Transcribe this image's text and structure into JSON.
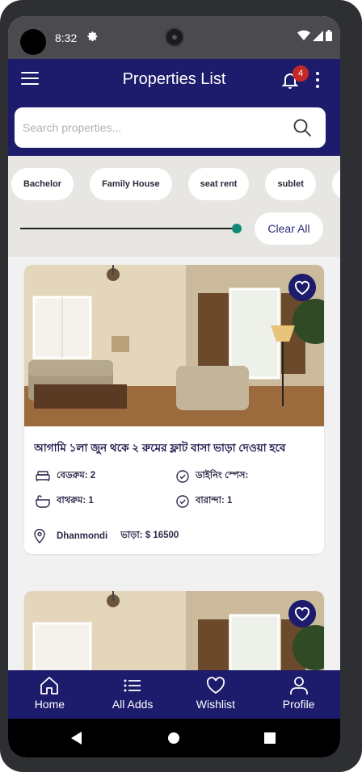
{
  "status_bar": {
    "time": "8:32",
    "icons": [
      "gear-icon",
      "wifi-icon",
      "signal-icon",
      "battery-icon"
    ]
  },
  "app_bar": {
    "title": "Properties List",
    "notification_count": "4",
    "search_placeholder": "Search properties..."
  },
  "filters": {
    "chips": [
      "Bachelor",
      "Family House",
      "seat rent",
      "sublet"
    ],
    "slider_value": 1.0,
    "clear_label": "Clear All"
  },
  "listings": [
    {
      "title": "আগামি ১লা জুন থকে ২ রুমের ফ্লাট বাসা ভাড়া দেওয়া হবে",
      "bedroom": "বেডরুম: 2",
      "dining": "ডাইনিং স্পেস:",
      "bathroom": "বাথরুম: 1",
      "balcony": "বারান্দা: 1",
      "area": "Dhanmondi",
      "rent": "ভাড়া: $ 16500"
    }
  ],
  "bottom_nav": [
    {
      "label": "Home",
      "icon": "home-icon"
    },
    {
      "label": "All Adds",
      "icon": "list-icon"
    },
    {
      "label": "Wishlist",
      "icon": "heart-icon"
    },
    {
      "label": "Profile",
      "icon": "person-icon"
    }
  ],
  "colors": {
    "primary": "#1d1b6b",
    "accent": "#0f8a78",
    "badge": "#c62828",
    "filter_bg": "#e7e6e2"
  }
}
